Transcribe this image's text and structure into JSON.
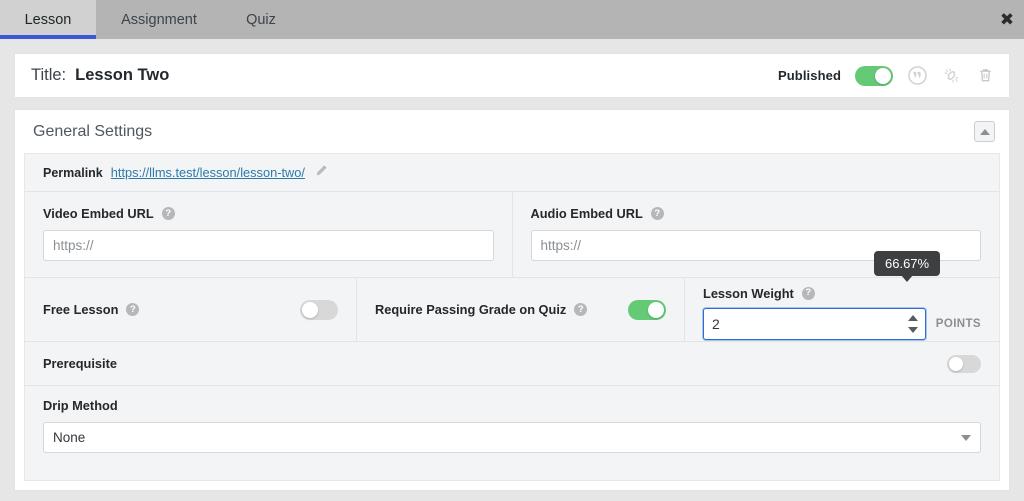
{
  "tabs": [
    {
      "label": "Lesson",
      "active": true
    },
    {
      "label": "Assignment",
      "active": false
    },
    {
      "label": "Quiz",
      "active": false
    }
  ],
  "window": {
    "close_label": "✖"
  },
  "title_bar": {
    "label": "Title:",
    "value": "Lesson Two",
    "published_label": "Published",
    "published_on": true,
    "icons": [
      "wordpress-icon",
      "unlink-icon",
      "trash-icon"
    ]
  },
  "panel": {
    "heading": "General Settings",
    "collapse_label": "▲"
  },
  "permalink": {
    "label": "Permalink",
    "url": "https://llms.test/lesson/lesson-two/",
    "edit_icon": "pencil-icon"
  },
  "video": {
    "label": "Video Embed URL",
    "help": "?",
    "value": "",
    "placeholder": "https://"
  },
  "audio": {
    "label": "Audio Embed URL",
    "help": "?",
    "value": "",
    "placeholder": "https://"
  },
  "free_lesson": {
    "label": "Free Lesson",
    "help": "?",
    "enabled": false
  },
  "passing_grade": {
    "label": "Require Passing Grade on Quiz",
    "help": "?",
    "enabled": true
  },
  "lesson_weight": {
    "label": "Lesson Weight",
    "help": "?",
    "value": "2",
    "unit": "POINTS",
    "tooltip": "66.67%"
  },
  "prerequisite": {
    "label": "Prerequisite",
    "enabled": false
  },
  "drip_method": {
    "label": "Drip Method",
    "value": "None",
    "options": [
      "None"
    ]
  },
  "colors": {
    "accent_blue": "#3858d6",
    "toggle_on": "#64ca75",
    "toggle_off": "#d8d8d8",
    "link": "#2c7ba8",
    "tooltip_bg": "#3d3f40",
    "focus_border": "#2a6dd4"
  }
}
